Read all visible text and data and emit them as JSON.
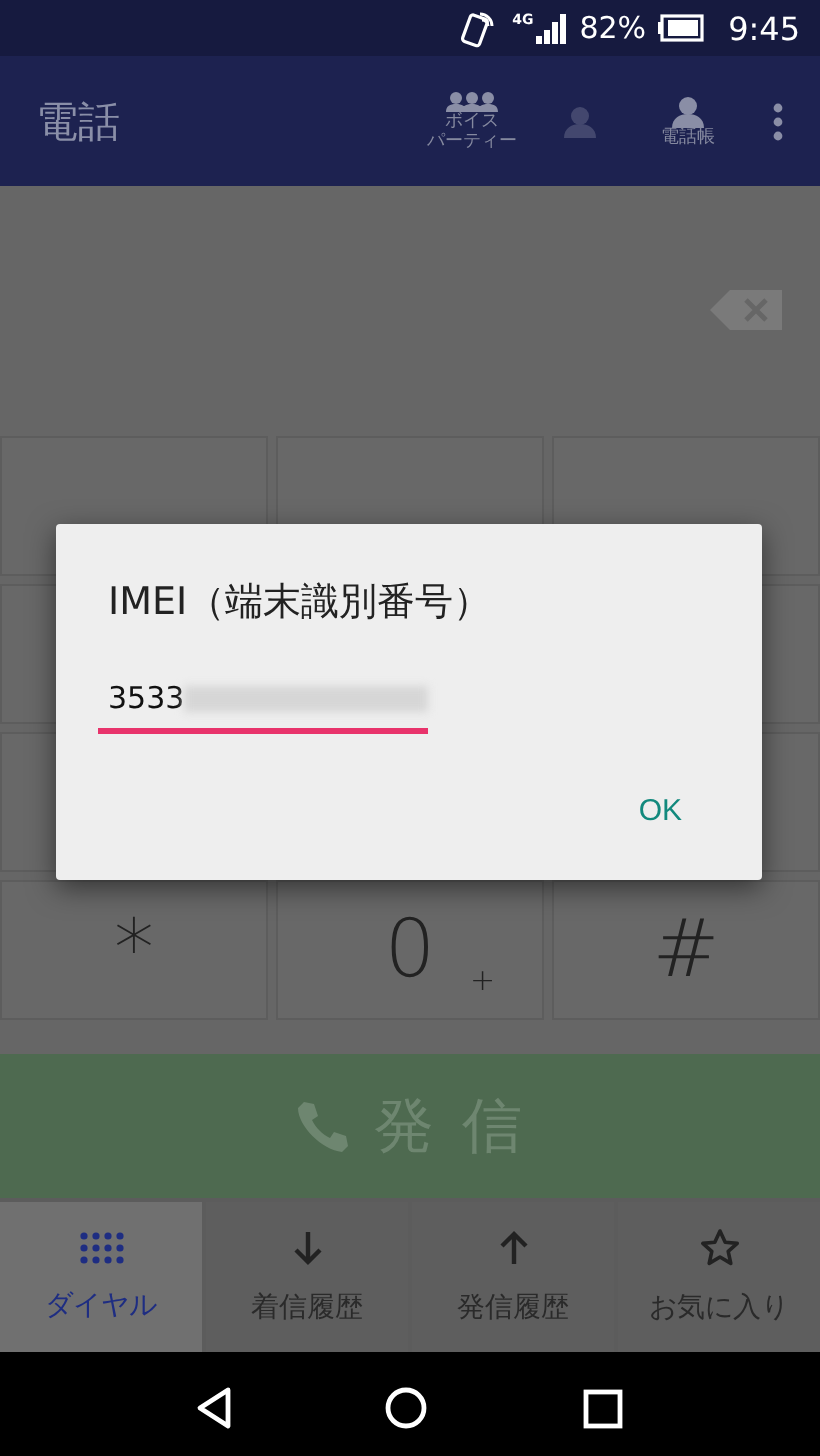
{
  "status_bar": {
    "network": "4G",
    "battery": "82%",
    "time": "9:45"
  },
  "app_bar": {
    "title": "電話",
    "actions": [
      {
        "kind": "group",
        "label_lines": [
          "ボイス",
          "パーティー"
        ]
      },
      {
        "kind": "person"
      },
      {
        "kind": "person",
        "label": "電話帳"
      },
      {
        "kind": "more"
      }
    ]
  },
  "keypad": {
    "bottom_keys": [
      {
        "digit": "*"
      },
      {
        "digit": "0",
        "sub": "+"
      },
      {
        "digit": "#"
      }
    ]
  },
  "call_button": {
    "label": "発 信"
  },
  "tabs": [
    {
      "kind": "dialpad",
      "label": "ダイヤル",
      "selected": true
    },
    {
      "kind": "incoming",
      "label": "着信履歴",
      "selected": false
    },
    {
      "kind": "outgoing",
      "label": "発信履歴",
      "selected": false
    },
    {
      "kind": "favorite",
      "label": "お気に入り",
      "selected": false
    }
  ],
  "dialog": {
    "title": "IMEI（端末識別番号）",
    "value": "3533",
    "redacted": true,
    "button": "OK"
  }
}
